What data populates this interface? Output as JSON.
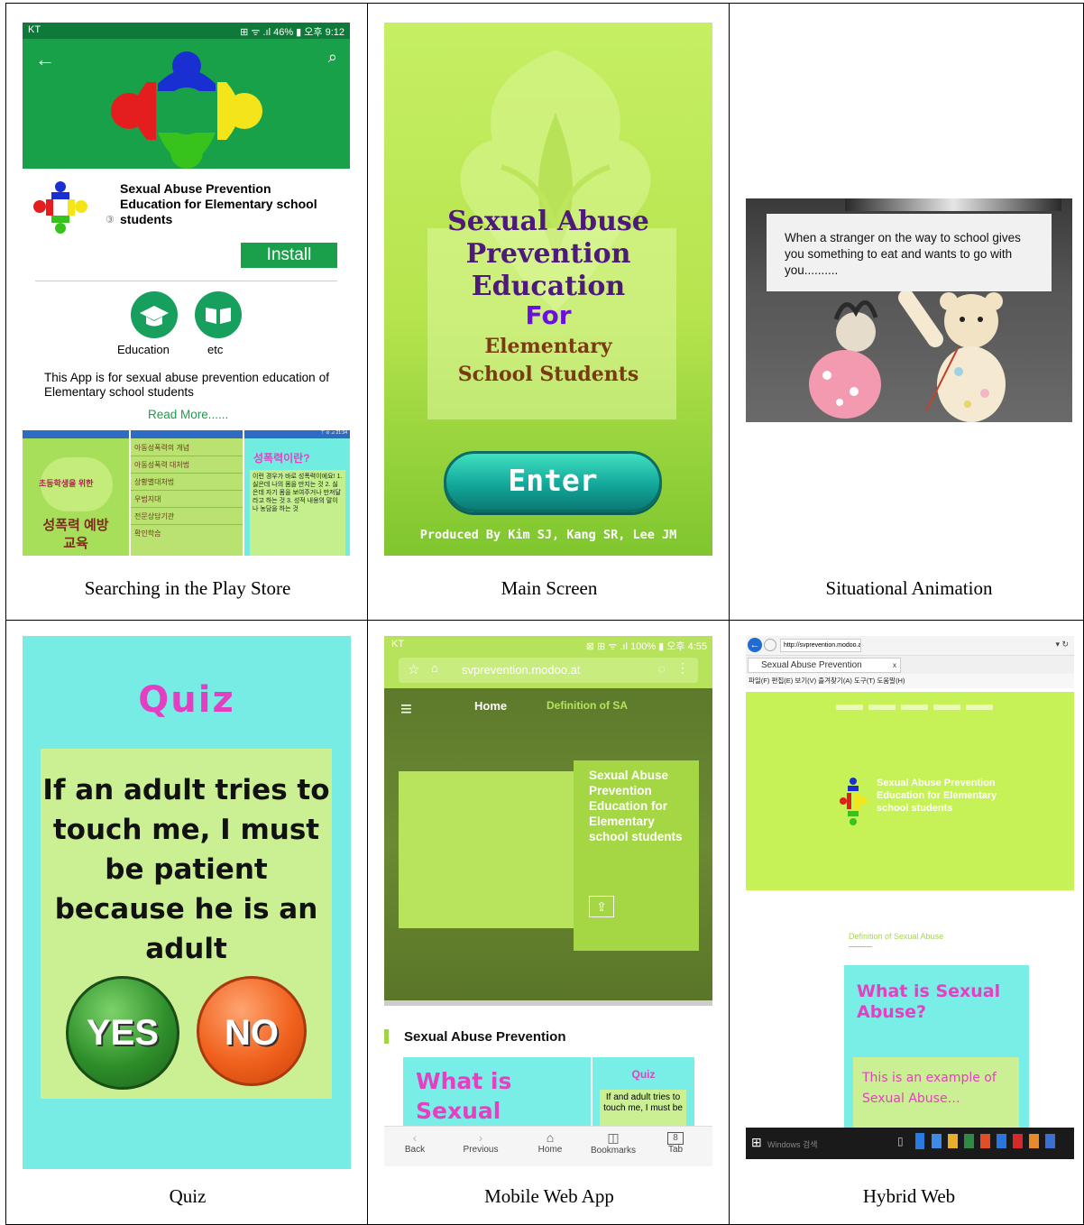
{
  "captions": [
    "Searching in the Play Store",
    "Main Screen",
    "Situational Animation",
    "Quiz",
    "Mobile Web App",
    "Hybrid Web"
  ],
  "play": {
    "status_left": "KT",
    "status_right": "⊞ ᯤ .ıl 46% ▮ 오후 9:12",
    "app_title": "Sexual Abuse Prevention Education for Elementary school students",
    "rating_badge": "③",
    "install": "Install",
    "cat1": "Education",
    "cat2": "etc",
    "description": "This App is for sexual abuse prevention education of Elementary school students",
    "read_more": "Read More......",
    "thumb1_title": "초등학생을 위한",
    "thumb1_sub": "성폭력 예방 교육",
    "thumb2_items": [
      "아동성폭력의 개념",
      "아동성폭력 대처법",
      "상황별대처법",
      "우범지대",
      "전문상담기관",
      "확인학습"
    ],
    "thumb3_title": "성폭력이란?",
    "thumb3_text": "이런 경우가 바로 성폭력이에요! 1. 싫은데 나의 몸을 만지는 것 2. 싫은데 자기 몸을 보여주거나 만져달라고 하는 것 3. 성적 내용의 말이나 농담을 하는 것",
    "thumb_status": "⊤ ⊙ ⊿ 21:34"
  },
  "main": {
    "title_l1": "Sexual Abuse",
    "title_l2": "Prevention",
    "title_l3": "Education",
    "title_for": "For",
    "title_l4": "Elementary",
    "title_l5": "School Students",
    "enter": "Enter",
    "credits": "Produced By Kim SJ, Kang SR, Lee JM"
  },
  "anim": {
    "bubble": "When a stranger on the way to school gives you something to eat and wants to go with you.........."
  },
  "quiz": {
    "title": "Quiz",
    "question": "If an adult tries to touch me, I must be patient because he is an adult",
    "yes": "YES",
    "no": "NO"
  },
  "mobile": {
    "status_left": "KT",
    "status_right": "⊠ ⊞ ᯤ .ıl 100% ▮ 오후 4:55",
    "url": "svprevention.modoo.at",
    "nav_home": "Home",
    "nav_def": "Definition of SA",
    "hero_text": "Sexual Abuse Prevention Education for Elementary school students",
    "section_title": "Sexual Abuse Prevention",
    "card1": "What is Sexual Abuse?",
    "card2_title": "Quiz",
    "card2_text": "If and adult tries to touch me, I must be",
    "tabs": [
      "Back",
      "Previous",
      "Home",
      "Bookmarks",
      "Tab"
    ],
    "tab_badge": "8"
  },
  "hybrid": {
    "address": "http://svprevention.modoo.at/",
    "tab": "Sexual Abuse Prevention",
    "menu": "파일(F)  편집(E)  보기(V)  즐겨찾기(A)  도구(T)  도움말(H)",
    "hero_text": "Sexual Abuse Prevention Education for Elementary school students",
    "section_link": "Definition of Sexual Abuse",
    "card_title": "What is Sexual Abuse?",
    "card_text": "This is an example of Sexual Abuse…",
    "taskbar_search": "Windows 검색"
  }
}
